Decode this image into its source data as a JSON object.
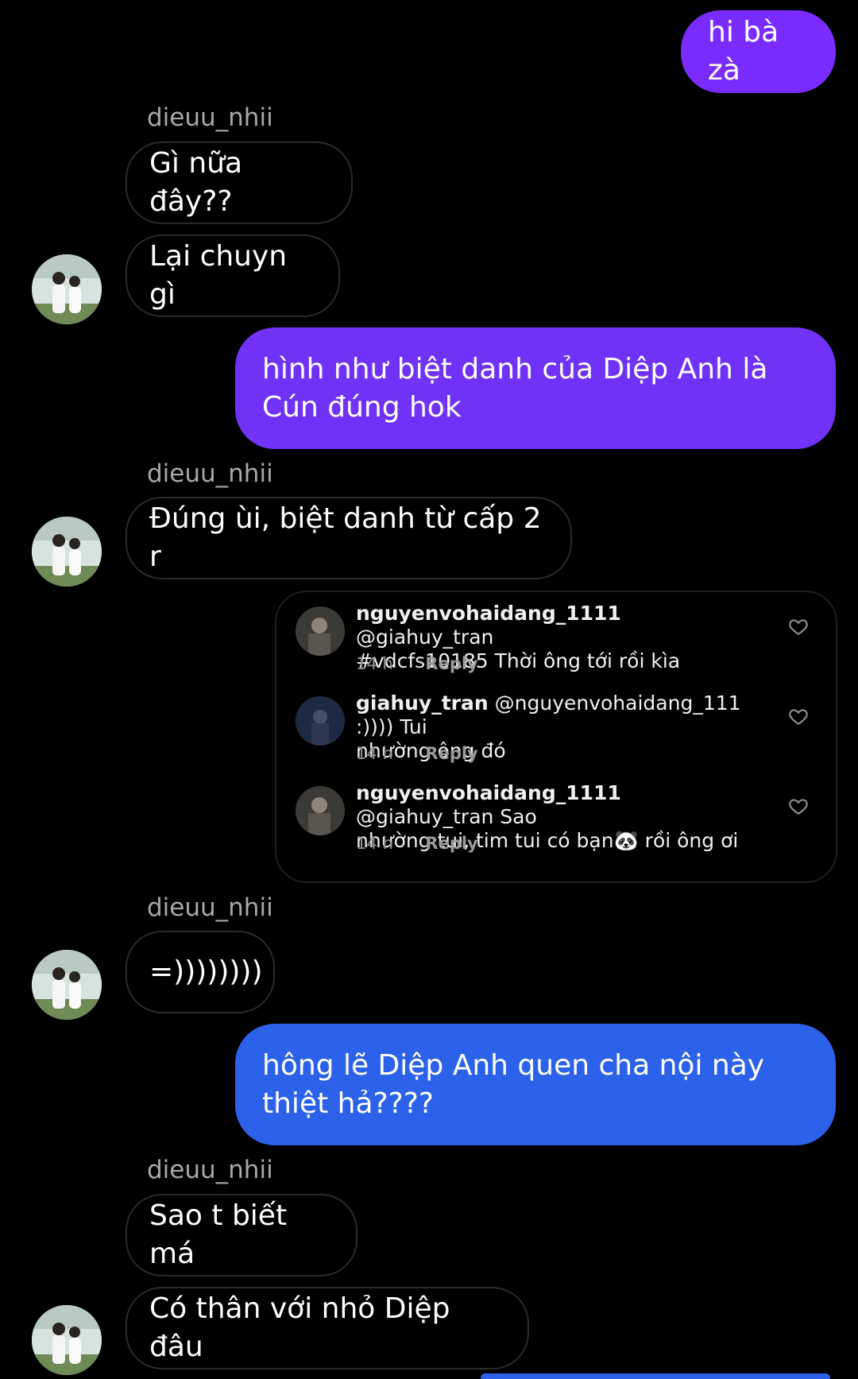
{
  "messages": {
    "m1": "hi bà zà",
    "m2_sender": "dieuu_nhii",
    "m2": "Gì nữa đây??",
    "m3": "Lại chuyn gì",
    "m4_line1": "hình như biệt danh của Diệp Anh là",
    "m4_line2": "Cún đúng hok",
    "m5_sender": "dieuu_nhii",
    "m5": "Đúng ùi, biệt danh từ cấp 2 r",
    "m6_sender": "dieuu_nhii",
    "m6": "=))))))))",
    "m7_line1": "hông lẽ Diệp Anh quen cha nội này",
    "m7_line2": "thiệt hả????",
    "m8_sender": "dieuu_nhii",
    "m8": "Sao t biết má",
    "m9": "Có thân với nhỏ Diệp đâu"
  },
  "shared_comments": [
    {
      "user": "nguyenvohaidang_1111",
      "text_line1": " @giahuy_tran",
      "text_line2": "#vdcfs10185 Thời ông tới rồi kìa",
      "time": "14 h",
      "reply": "Reply"
    },
    {
      "user": "giahuy_tran",
      "text_line1": " @nguyenvohaidang_111 :)))) Tui",
      "text_line2": "nhường ông đó",
      "time": "14 h",
      "reply": "Reply"
    },
    {
      "user": "nguyenvohaidang_1111",
      "text_line1": " @giahuy_tran Sao",
      "text_line2": "nhường tui, tim tui có bạn🐼 rồi ông ơi",
      "time": "14 h",
      "reply": "Reply"
    }
  ],
  "icons": {
    "avatar": "couple-photo-avatar",
    "comment_like": "heart-outline-icon"
  },
  "colors": {
    "background": "#000000",
    "incoming_border": "#2b2b2b",
    "outgoing_purple": "#7a2cff",
    "outgoing_violet": "#6f32f6",
    "outgoing_blue": "#2c62ea",
    "sender_name": "#a8a8a8"
  }
}
